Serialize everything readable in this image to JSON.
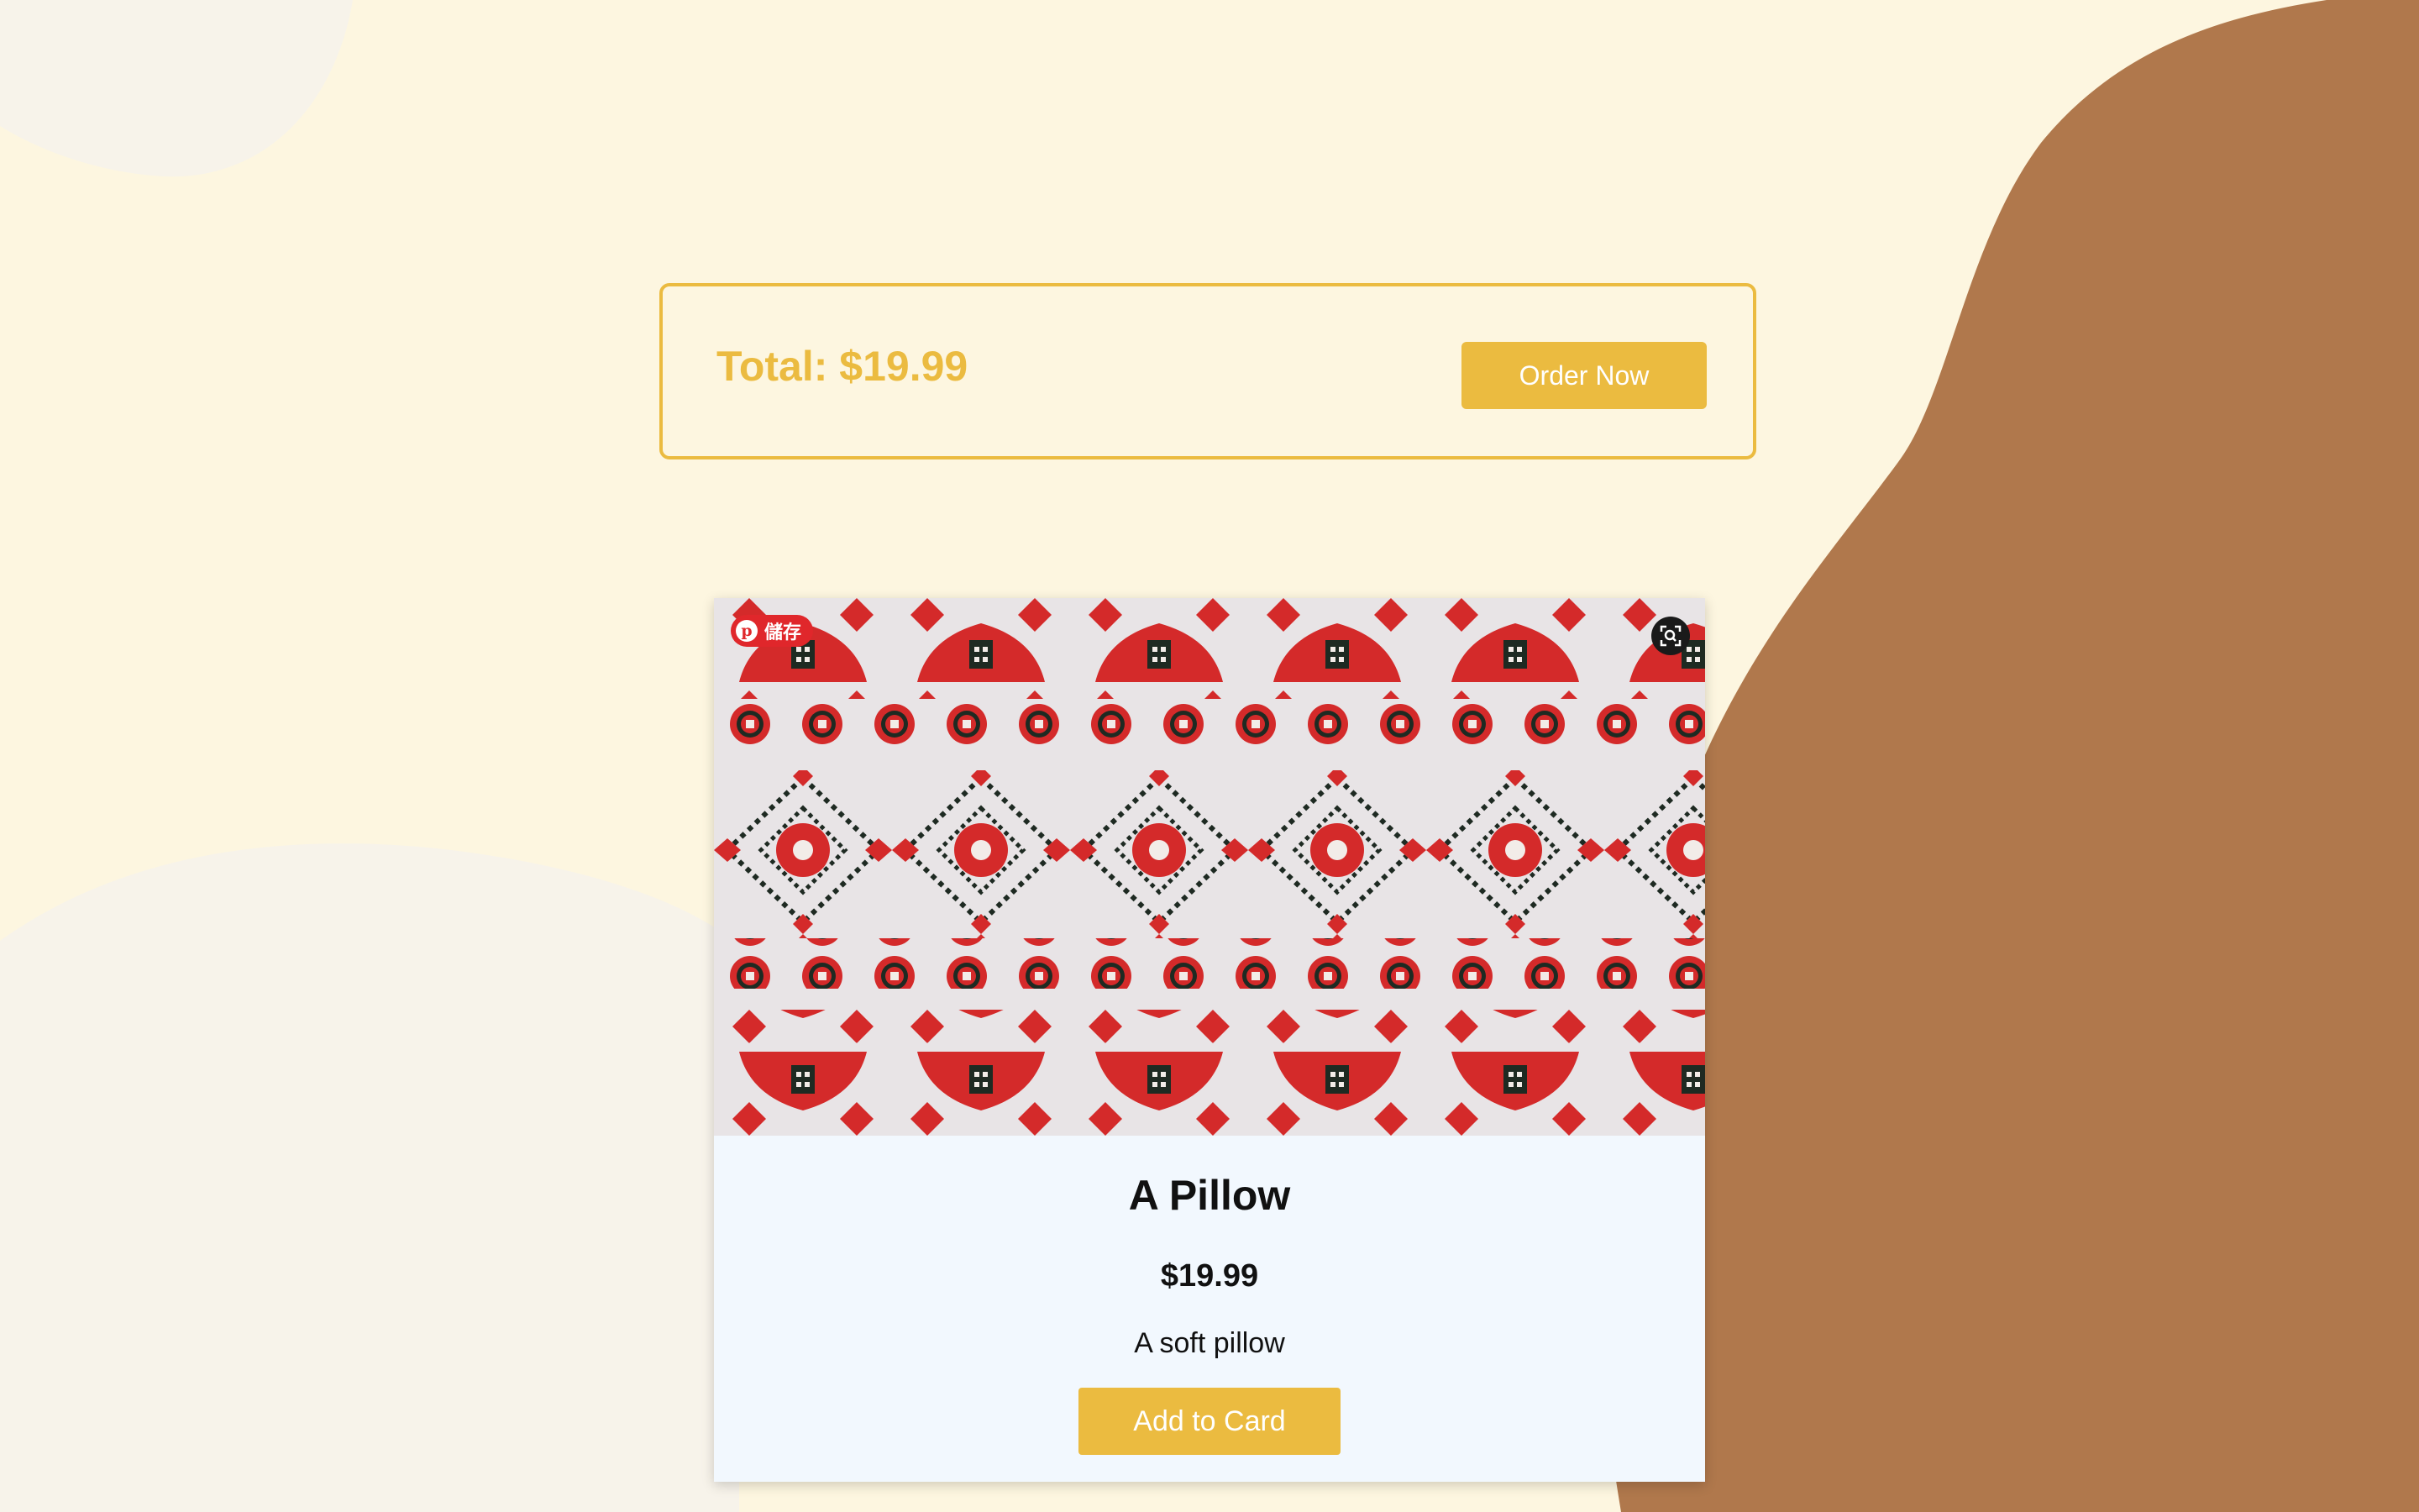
{
  "summary": {
    "total_label": "Total: $19.99",
    "order_button": "Order Now"
  },
  "product": {
    "name": "A Pillow",
    "price": "$19.99",
    "description": "A soft pillow",
    "add_button": "Add to Card",
    "image_alt": "Embroidered pillow with red and black cross-stitch pattern"
  },
  "image_overlay": {
    "save_label": "儲存",
    "save_icon": "pinterest-icon",
    "lens_icon": "visual-search-icon"
  },
  "colors": {
    "background": "#fdf6e0",
    "blob_brown": "#b0784c",
    "blob_light": "#f7f3ea",
    "accent": "#ebbb40",
    "card_bg": "#f2f8fe",
    "embroidery_red": "#d42a2a",
    "embroidery_dark": "#1e2a22"
  }
}
